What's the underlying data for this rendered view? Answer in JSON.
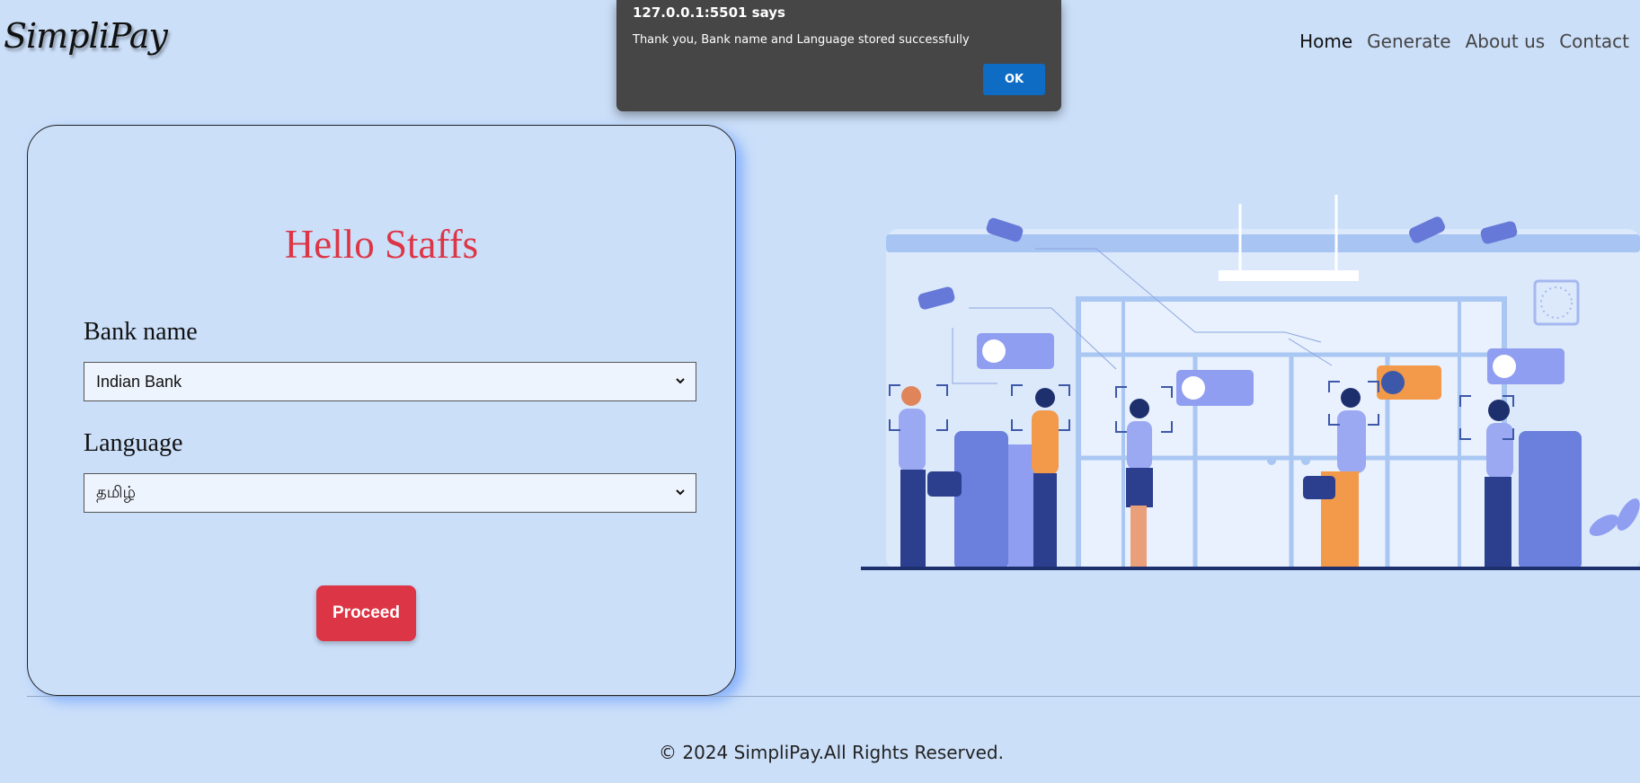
{
  "header": {
    "logo": "SimpliPay",
    "nav": [
      "Home",
      "Generate",
      "About us",
      "Contact"
    ]
  },
  "form": {
    "heading": "Hello Staffs",
    "bank_label": "Bank name",
    "bank_value": "Indian Bank",
    "language_label": "Language",
    "language_value": "தமிழ்",
    "proceed_label": "Proceed"
  },
  "footer": {
    "text": "© 2024 SimpliPay.All Rights Reserved."
  },
  "dialog": {
    "title": "127.0.0.1:5501 says",
    "message": "Thank you, Bank name and Language stored successfully",
    "ok_label": "OK"
  },
  "colors": {
    "background": "#cbdff9",
    "accent_red": "#dc3545",
    "dialog_bg": "#464646",
    "ok_blue": "#0f6cc4"
  },
  "icons": {
    "select_arrow": "chevron-down-icon",
    "illustration": "bank-queue-surveillance-illustration"
  }
}
